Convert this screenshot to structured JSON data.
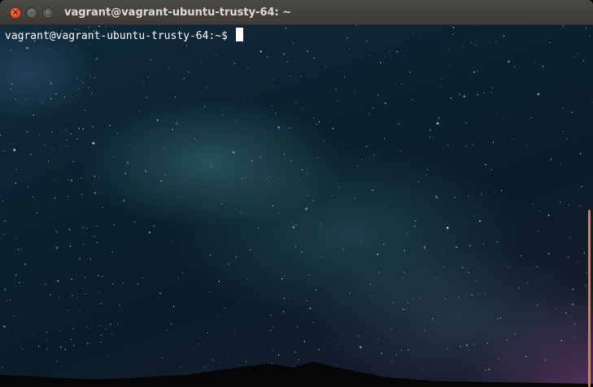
{
  "window": {
    "title": "vagrant@vagrant-ubuntu-trusty-64: ~",
    "buttons": {
      "close_icon": "close-icon",
      "minimize_icon": "minimize-icon",
      "maximize_icon": "maximize-icon"
    }
  },
  "terminal": {
    "prompt": "vagrant@vagrant-ubuntu-trusty-64:~$",
    "input": ""
  },
  "colors": {
    "accent": "#e95420",
    "scrollbar": "#e2793e",
    "titlebar": "#3c3b37",
    "text": "#ffffff"
  }
}
